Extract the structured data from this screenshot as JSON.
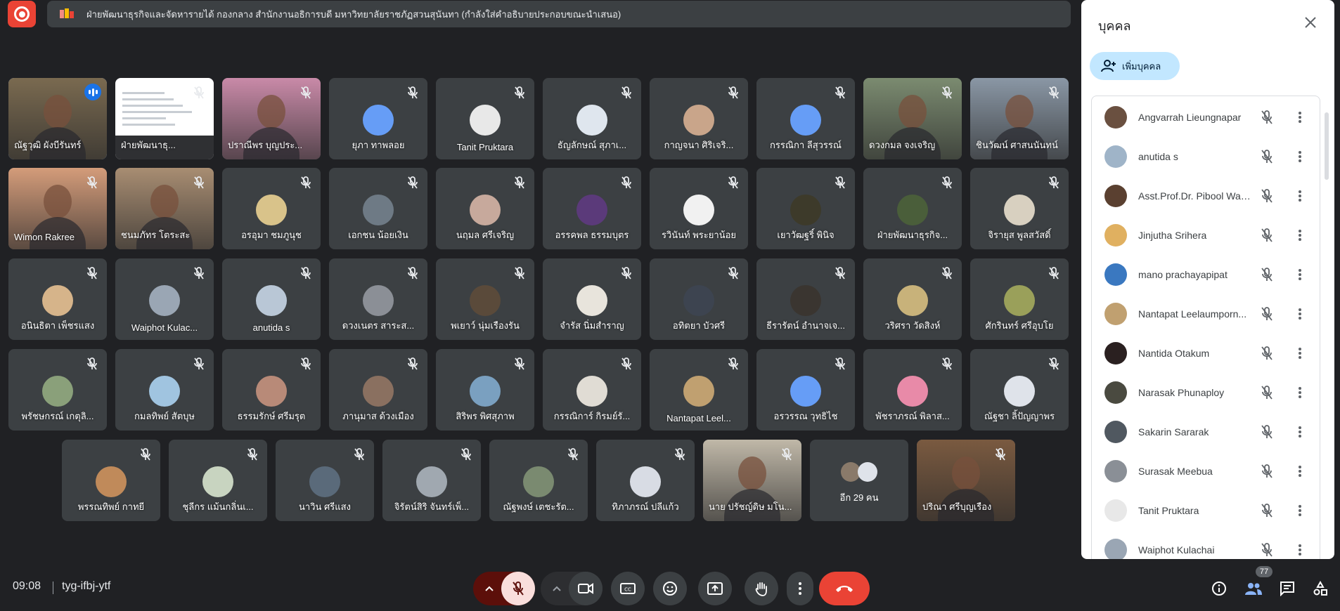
{
  "presentation": {
    "title": "ฝ่ายพัฒนาธุรกิจและจัดหารายได้ กองกลาง สำนักงานอธิการบดี มหาวิทยาลัยราชภัฏสวนสุนันทา (กำลังใส่คำอธิบายประกอบขณะนำเสนอ)"
  },
  "tiles": [
    {
      "name": "ณัฐวุฒิ ผังบีรันทร์",
      "kind": "video",
      "speaking": true,
      "color": "#7a6a50"
    },
    {
      "name": "ฝ่ายพัฒนาธุ...",
      "kind": "screen",
      "color": "#e8eaed"
    },
    {
      "name": "ปราณีพร บุญประ...",
      "kind": "video",
      "color": "#c98aa8"
    },
    {
      "name": "ยุภา ทาพลอย",
      "kind": "avatar",
      "color": "#669df6"
    },
    {
      "name": "Tanit Pruktara",
      "kind": "avatar",
      "color": "#e8e8e8"
    },
    {
      "name": "ธัญลักษณ์ สุภาเ...",
      "kind": "avatar",
      "color": "#dfe6ee"
    },
    {
      "name": "กาญจนา ศิริเจริ...",
      "kind": "avatar",
      "color": "#c9a58a"
    },
    {
      "name": "กรรณิกา ลีสุวรรณ์",
      "kind": "avatar",
      "color": "#669df6"
    },
    {
      "name": "ดวงกมล จงเจริญ",
      "kind": "video",
      "color": "#7b8b70"
    },
    {
      "name": "ชินวัฒน์ ศาสนนันทน์",
      "kind": "video",
      "color": "#8a97a5"
    },
    {
      "name": "Wimon Rakree",
      "kind": "video",
      "color": "#d49c7a"
    },
    {
      "name": "ชนมภัทร โตระสะ",
      "kind": "video",
      "color": "#a88d72"
    },
    {
      "name": "อรอุมา ชมภูนุช",
      "kind": "avatar",
      "color": "#d9c38a"
    },
    {
      "name": "เอกชน น้อยเงิน",
      "kind": "avatar",
      "color": "#6e7a85"
    },
    {
      "name": "นฤมล ศรีเจริญ",
      "kind": "avatar",
      "color": "#c7a99c"
    },
    {
      "name": "อรรคพล ธรรมบุตร",
      "kind": "avatar",
      "color": "#5b3a7a"
    },
    {
      "name": "รวินันท์ พระยาน้อย",
      "kind": "avatar",
      "color": "#f1f1f1"
    },
    {
      "name": "เยาวัฒฐริ์ พินิจ",
      "kind": "avatar",
      "color": "#3d3a2a"
    },
    {
      "name": "ฝ่ายพัฒนาธุรกิจ...",
      "kind": "avatar",
      "color": "#4a5e3a"
    },
    {
      "name": "จิรายุส พูลสวัสดิ์",
      "kind": "avatar",
      "color": "#d8d0c0"
    },
    {
      "name": "อนินธิตา เพ็ชรแสง",
      "kind": "avatar",
      "color": "#d6b48a"
    },
    {
      "name": "Waiphot Kulac...",
      "kind": "avatar",
      "color": "#9aa6b4"
    },
    {
      "name": "anutida s",
      "kind": "avatar",
      "color": "#b9c7d6"
    },
    {
      "name": "ดวงเนตร สาระส...",
      "kind": "avatar",
      "color": "#8b8f96"
    },
    {
      "name": "พเยาว์ นุ่มเรืองรัน",
      "kind": "avatar",
      "color": "#5a4a3a"
    },
    {
      "name": "จำรัส นิ่มสำราญ",
      "kind": "avatar",
      "color": "#e8e4dc"
    },
    {
      "name": "อทิตยา บัวศรี",
      "kind": "avatar",
      "color": "#3d4450"
    },
    {
      "name": "ธีรารัตน์ อำนาจเจ...",
      "kind": "avatar",
      "color": "#3a3530"
    },
    {
      "name": "วริศรา วัดสิงห์",
      "kind": "avatar",
      "color": "#c8b27a"
    },
    {
      "name": "ศักรินทร์ ศรีอุบโย",
      "kind": "avatar",
      "color": "#9aa05a"
    },
    {
      "name": "พรัชษกรณ์ เกตุลิ...",
      "kind": "avatar",
      "color": "#8aa07a"
    },
    {
      "name": "กมลทิพย์ สัตบุษ",
      "kind": "avatar",
      "color": "#a0c4e0"
    },
    {
      "name": "ธรรมรักษ์ ศรีมรุต",
      "kind": "avatar",
      "color": "#b88a78"
    },
    {
      "name": "ภานุมาส ด้วงเมือง",
      "kind": "avatar",
      "color": "#8a7060"
    },
    {
      "name": "สิริพร พิศสุภาพ",
      "kind": "avatar",
      "color": "#7aa0c0"
    },
    {
      "name": "กรรณิการ์ กิรมย์รั...",
      "kind": "avatar",
      "color": "#e0dcd4"
    },
    {
      "name": "Nantapat Leel...",
      "kind": "avatar",
      "color": "#c0a070"
    },
    {
      "name": "อรวรรณ วุทธิไช",
      "kind": "avatar",
      "color": "#669df6"
    },
    {
      "name": "พัชราภรณ์ พิลาส...",
      "kind": "avatar",
      "color": "#e88aa8"
    },
    {
      "name": "ณัฐชา ลิ้ปัญญาพร",
      "kind": "avatar",
      "color": "#dfe3ea"
    },
    {
      "name": "พรรณทิพย์ กาทยี",
      "kind": "avatar",
      "color": "#c08a5a"
    },
    {
      "name": "ชุลีกร แม้นกลิ่นเ...",
      "kind": "avatar",
      "color": "#c8d4c0"
    },
    {
      "name": "นาวิน ศรีแสง",
      "kind": "avatar",
      "color": "#5a6a7a"
    },
    {
      "name": "จิรัตน์สิริ จันทร์เพ็...",
      "kind": "avatar",
      "color": "#a0a8b0"
    },
    {
      "name": "ณัฐพงษ์ เตชะรัต...",
      "kind": "avatar",
      "color": "#7a8a70"
    },
    {
      "name": "ทิภาภรณ์ ปลีแก้ว",
      "kind": "avatar",
      "color": "#d8dce4"
    },
    {
      "name": "นาย ปรัชญ์ดิษ มโน...",
      "kind": "video",
      "color": "#c0b8a8"
    },
    {
      "name": "อีก 29 คน",
      "kind": "more",
      "color": "#3c4043"
    },
    {
      "name": "ปริณา ศรีบุญเรือง",
      "kind": "video",
      "color": "#7a5a40"
    }
  ],
  "panel": {
    "title": "บุคคล",
    "add_label": "เพิ่มบุคคล",
    "people": [
      {
        "name": "Angvarrah Lieungnapar",
        "color": "#6a5040"
      },
      {
        "name": "anutida s",
        "color": "#9fb4c8"
      },
      {
        "name": "Asst.Prof.Dr. Pibool Waij...",
        "color": "#5a4030"
      },
      {
        "name": "Jinjutha Srihera",
        "color": "#e0b060"
      },
      {
        "name": "mano prachayapipat",
        "color": "#3a78c0"
      },
      {
        "name": "Nantapat Leelaumporn...",
        "color": "#c0a070"
      },
      {
        "name": "Nantida Otakum",
        "color": "#2a2020"
      },
      {
        "name": "Narasak Phunaploy",
        "color": "#4a4a40"
      },
      {
        "name": "Sakarin Sararak",
        "color": "#505860"
      },
      {
        "name": "Surasak Meebua",
        "color": "#8a8f96"
      },
      {
        "name": "Tanit Pruktara",
        "color": "#e8e8e8"
      },
      {
        "name": "Waiphot Kulachai",
        "color": "#9aa6b4"
      }
    ]
  },
  "bottom": {
    "time": "09:08",
    "meeting_code": "tyg-ifbj-ytf",
    "participants_count": "77"
  }
}
